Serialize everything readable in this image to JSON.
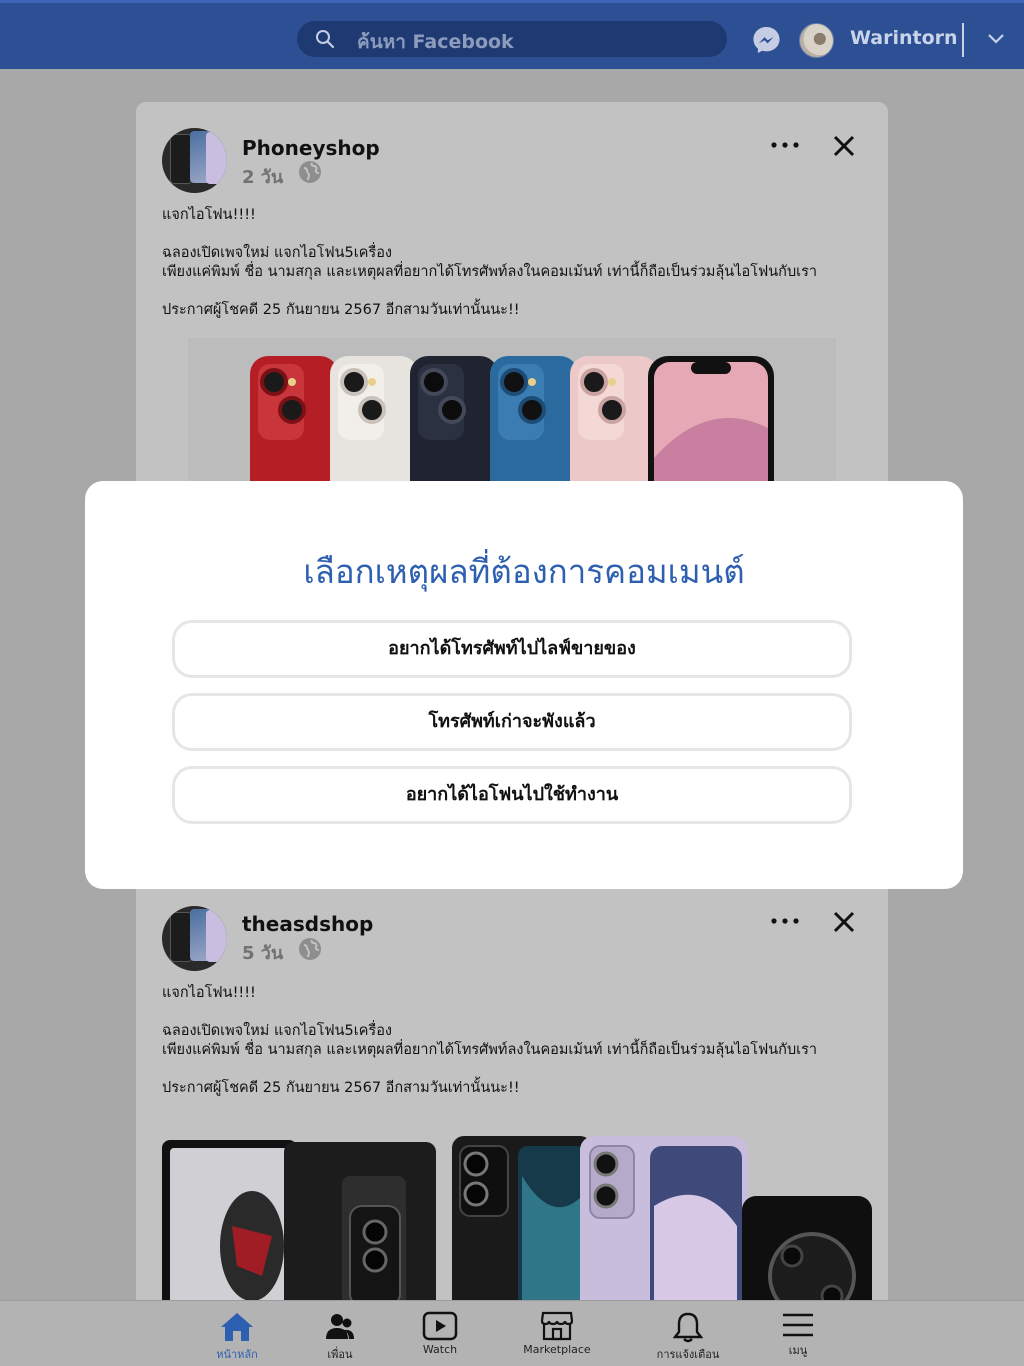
{
  "header": {
    "search_placeholder": "ค้นหา Facebook",
    "username": "Warintorn"
  },
  "posts": [
    {
      "author": "Phoneyshop",
      "time": "2 วัน",
      "lines": [
        "แจกไอโฟน!!!!",
        "",
        "ฉลองเปิดเพจใหม่ แจกไอโฟน5เครื่อง",
        "เพียงแค่พิมพ์ ชื่อ นามสกุล และเหตุผลที่อยากได้โทรศัพท์ลงในคอมเม้นท์ เท่านี้ก็ถือเป็นร่วมลุ้นไอโฟนกับเรา",
        "",
        "ประกาศผู้โชคดี 25 กันยายน 2567 อีกสามวันเท่านั้นนะ!!"
      ]
    },
    {
      "author": "theasdshop",
      "time": "5 วัน",
      "lines": [
        "แจกไอโฟน!!!!",
        "",
        "ฉลองเปิดเพจใหม่ แจกไอโฟน5เครื่อง",
        "เพียงแค่พิมพ์ ชื่อ นามสกุล และเหตุผลที่อยากได้โทรศัพท์ลงในคอมเม้นท์ เท่านี้ก็ถือเป็นร่วมลุ้นไอโฟนกับเรา",
        "",
        "ประกาศผู้โชคดี 25 กันยายน 2567 อีกสามวันเท่านั้นนะ!!"
      ]
    }
  ],
  "modal": {
    "title": "เลือกเหตุผลที่ต้องการคอมเมนต์",
    "options": [
      "อยากได้โทรศัพท์ไปไลฟ์ขายของ",
      "โทรศัพท์เก่าจะพังแล้ว",
      "อยากได้ไอโฟนไปใช้ทำงาน"
    ]
  },
  "bottom_nav": [
    {
      "label": "หน้าหลัก",
      "icon": "home-icon",
      "active": true
    },
    {
      "label": "เพื่อน",
      "icon": "friends-icon",
      "active": false
    },
    {
      "label": "Watch",
      "icon": "watch-icon",
      "active": false
    },
    {
      "label": "Marketplace",
      "icon": "marketplace-icon",
      "active": false
    },
    {
      "label": "การแจ้งเตือน",
      "icon": "bell-icon",
      "active": false
    },
    {
      "label": "เมนู",
      "icon": "menu-icon",
      "active": false
    }
  ],
  "colors": {
    "topbar": "#2d4f93",
    "accent": "#2e60b2",
    "overlay": "#a8a8a8"
  }
}
